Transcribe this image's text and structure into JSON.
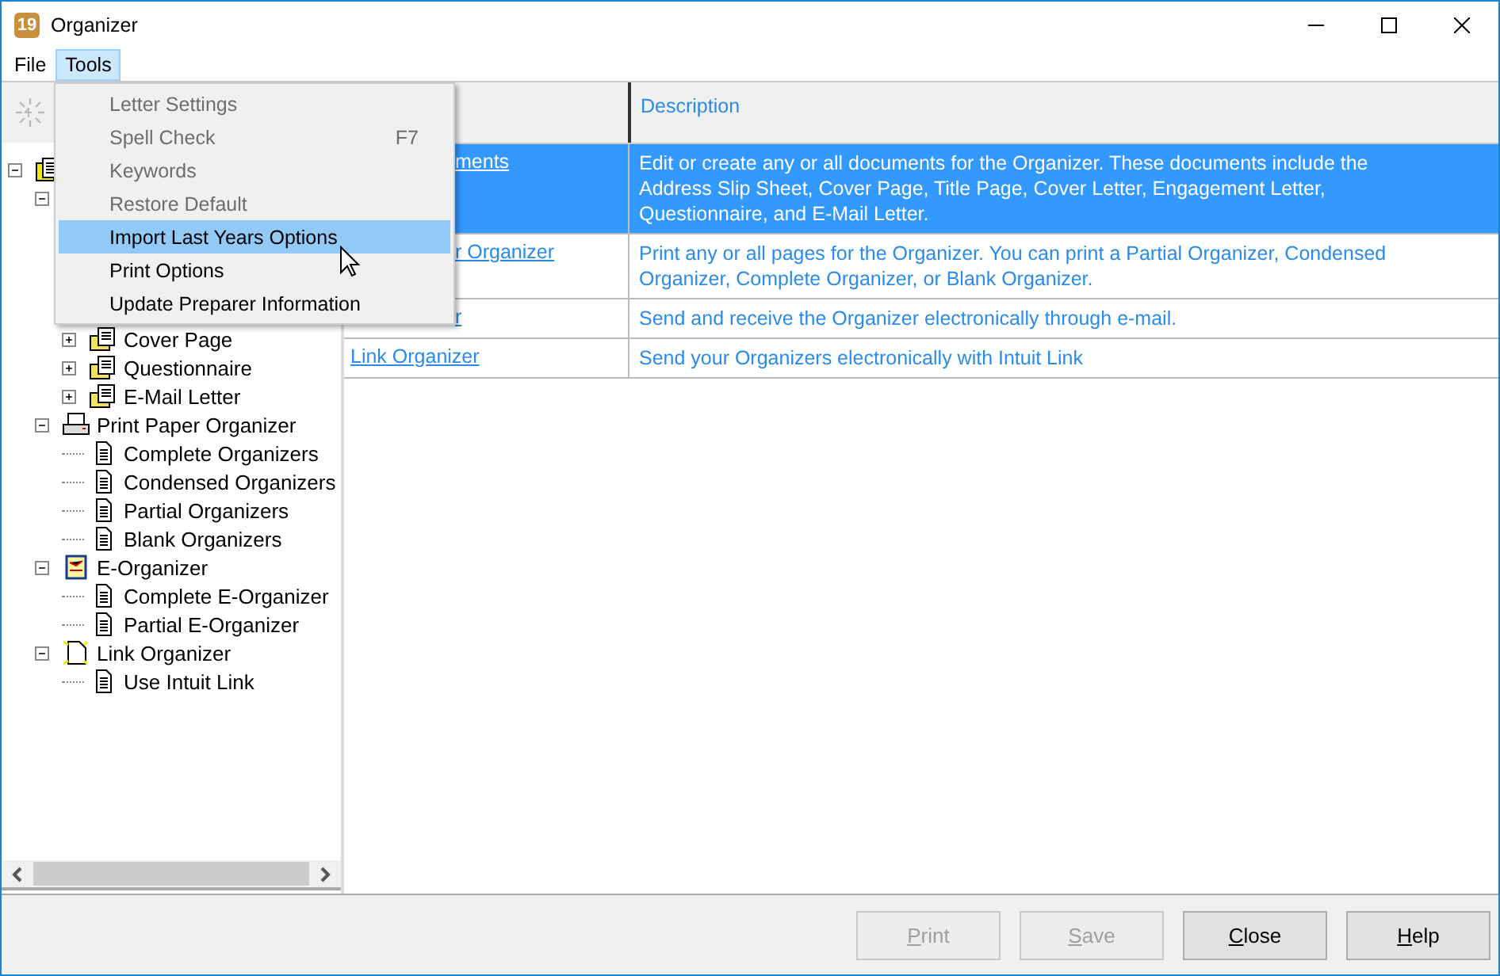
{
  "window": {
    "title": "Organizer",
    "badge": "19"
  },
  "menu_bar": [
    {
      "label": "File",
      "selected": false
    },
    {
      "label": "Tools",
      "selected": true
    }
  ],
  "tools_menu": [
    {
      "label": "Letter Settings",
      "disabled": true,
      "selected": false
    },
    {
      "label": "Spell Check",
      "shortcut": "F7",
      "disabled": true,
      "selected": false
    },
    {
      "label": "Keywords",
      "disabled": true,
      "selected": false
    },
    {
      "label": "Restore Default",
      "disabled": true,
      "selected": false
    },
    {
      "label": "Import Last Years Options",
      "disabled": false,
      "selected": true
    },
    {
      "label": "Print Options",
      "disabled": false,
      "selected": false
    },
    {
      "label": "Update Preparer Information",
      "disabled": false,
      "selected": false
    }
  ],
  "tree": [
    {
      "kind": "stack",
      "expanded": true,
      "children": [
        {
          "kind": "none",
          "expanded": true,
          "children": [
            {
              "kind": "folder-doc",
              "label": "Cover Page",
              "expanded": false
            },
            {
              "kind": "folder-doc",
              "label": "Questionnaire",
              "expanded": false
            },
            {
              "kind": "folder-doc",
              "label": "E-Mail Letter",
              "expanded": false
            }
          ]
        },
        {
          "kind": "printer",
          "label": "Print Paper Organizer",
          "expanded": true,
          "children": [
            {
              "kind": "page",
              "label": "Complete Organizers"
            },
            {
              "kind": "page",
              "label": "Condensed Organizers"
            },
            {
              "kind": "page",
              "label": "Partial Organizers"
            },
            {
              "kind": "page",
              "label": "Blank Organizers"
            }
          ]
        },
        {
          "kind": "eorg",
          "label": "E-Organizer",
          "expanded": true,
          "children": [
            {
              "kind": "page",
              "label": "Complete E-Organizer"
            },
            {
              "kind": "page",
              "label": "Partial E-Organizer"
            }
          ]
        },
        {
          "kind": "link",
          "label": "Link Organizer",
          "expanded": true,
          "children": [
            {
              "kind": "page",
              "label": "Use Intuit Link"
            }
          ]
        }
      ]
    }
  ],
  "table": {
    "description_header": "Description",
    "rows": [
      {
        "link": "ments",
        "description": "Edit or create any or all documents for the Organizer. These documents include the Address Slip Sheet, Cover Page, Title Page, Cover Letter, Engagement Letter, Questionnaire, and E-Mail Letter.",
        "selected": true,
        "full": false
      },
      {
        "link": "r Organizer",
        "description": "Print any or all pages for the Organizer. You can print a Partial Organizer, Condensed Organizer, Complete Organizer, or Blank Organizer.",
        "selected": false,
        "full": false
      },
      {
        "link": "r",
        "description": "Send and receive the Organizer electronically through e-mail.",
        "selected": false,
        "full": false
      },
      {
        "link": "Link Organizer",
        "description": "Send your Organizers electronically with Intuit Link",
        "selected": false,
        "full": true
      }
    ]
  },
  "buttons": [
    {
      "label": "Print",
      "disabled": true
    },
    {
      "label": "Save",
      "disabled": true
    },
    {
      "label": "Close",
      "disabled": false
    },
    {
      "label": "Help",
      "disabled": false
    }
  ]
}
